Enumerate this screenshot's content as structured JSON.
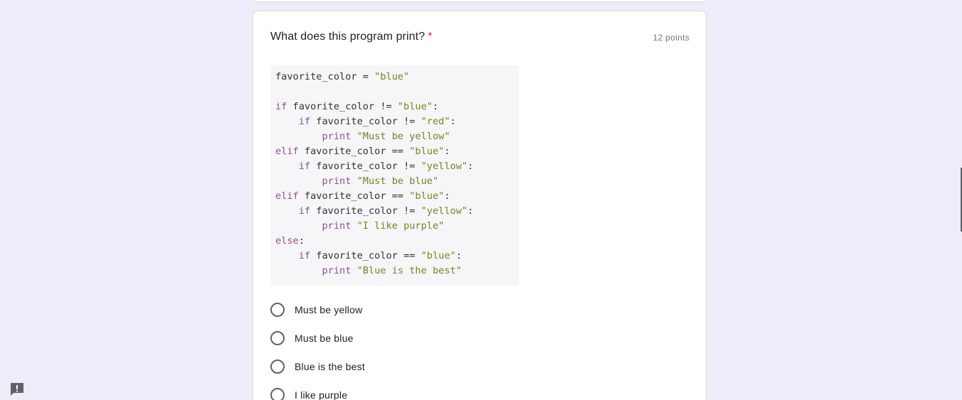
{
  "question": {
    "title": "What does this program print?",
    "required_marker": "*",
    "points": "12 points"
  },
  "code_lines": [
    [
      {
        "t": "plain",
        "s": "favorite_color = "
      },
      {
        "t": "str",
        "s": "\"blue\""
      }
    ],
    [],
    [
      {
        "t": "kw",
        "s": "if"
      },
      {
        "t": "plain",
        "s": " favorite_color != "
      },
      {
        "t": "str",
        "s": "\"blue\""
      },
      {
        "t": "plain",
        "s": ":"
      }
    ],
    [
      {
        "t": "plain",
        "s": "    "
      },
      {
        "t": "kw",
        "s": "if"
      },
      {
        "t": "plain",
        "s": " favorite_color != "
      },
      {
        "t": "str",
        "s": "\"red\""
      },
      {
        "t": "plain",
        "s": ":"
      }
    ],
    [
      {
        "t": "plain",
        "s": "        "
      },
      {
        "t": "kw",
        "s": "print"
      },
      {
        "t": "plain",
        "s": " "
      },
      {
        "t": "str",
        "s": "\"Must be yellow\""
      }
    ],
    [
      {
        "t": "kw",
        "s": "elif"
      },
      {
        "t": "plain",
        "s": " favorite_color == "
      },
      {
        "t": "str",
        "s": "\"blue\""
      },
      {
        "t": "plain",
        "s": ":"
      }
    ],
    [
      {
        "t": "plain",
        "s": "    "
      },
      {
        "t": "kw",
        "s": "if"
      },
      {
        "t": "plain",
        "s": " favorite_color != "
      },
      {
        "t": "str",
        "s": "\"yellow\""
      },
      {
        "t": "plain",
        "s": ":"
      }
    ],
    [
      {
        "t": "plain",
        "s": "        "
      },
      {
        "t": "kw",
        "s": "print"
      },
      {
        "t": "plain",
        "s": " "
      },
      {
        "t": "str",
        "s": "\"Must be blue\""
      }
    ],
    [
      {
        "t": "kw",
        "s": "elif"
      },
      {
        "t": "plain",
        "s": " favorite_color == "
      },
      {
        "t": "str",
        "s": "\"blue\""
      },
      {
        "t": "plain",
        "s": ":"
      }
    ],
    [
      {
        "t": "plain",
        "s": "    "
      },
      {
        "t": "kw",
        "s": "if"
      },
      {
        "t": "plain",
        "s": " favorite_color != "
      },
      {
        "t": "str",
        "s": "\"yellow\""
      },
      {
        "t": "plain",
        "s": ":"
      }
    ],
    [
      {
        "t": "plain",
        "s": "        "
      },
      {
        "t": "kw",
        "s": "print"
      },
      {
        "t": "plain",
        "s": " "
      },
      {
        "t": "str",
        "s": "\"I like purple\""
      }
    ],
    [
      {
        "t": "kw",
        "s": "else"
      },
      {
        "t": "plain",
        "s": ":"
      }
    ],
    [
      {
        "t": "plain",
        "s": "    "
      },
      {
        "t": "kw",
        "s": "if"
      },
      {
        "t": "plain",
        "s": " favorite_color == "
      },
      {
        "t": "str",
        "s": "\"blue\""
      },
      {
        "t": "plain",
        "s": ":"
      }
    ],
    [
      {
        "t": "plain",
        "s": "        "
      },
      {
        "t": "kw",
        "s": "print"
      },
      {
        "t": "plain",
        "s": " "
      },
      {
        "t": "str",
        "s": "\"Blue is the best\""
      }
    ]
  ],
  "options": [
    {
      "label": "Must be yellow"
    },
    {
      "label": "Must be blue"
    },
    {
      "label": "Blue is the best"
    },
    {
      "label": "I like purple"
    }
  ],
  "icons": {
    "report": "report-problem-icon",
    "radio": "radio-unchecked-icon"
  },
  "colors": {
    "page_background": "#f0ebf8",
    "required_marker": "#d93025",
    "keyword": "#8f4f9c",
    "string": "#6b8a1f",
    "code_background": "#f6f6f8"
  }
}
